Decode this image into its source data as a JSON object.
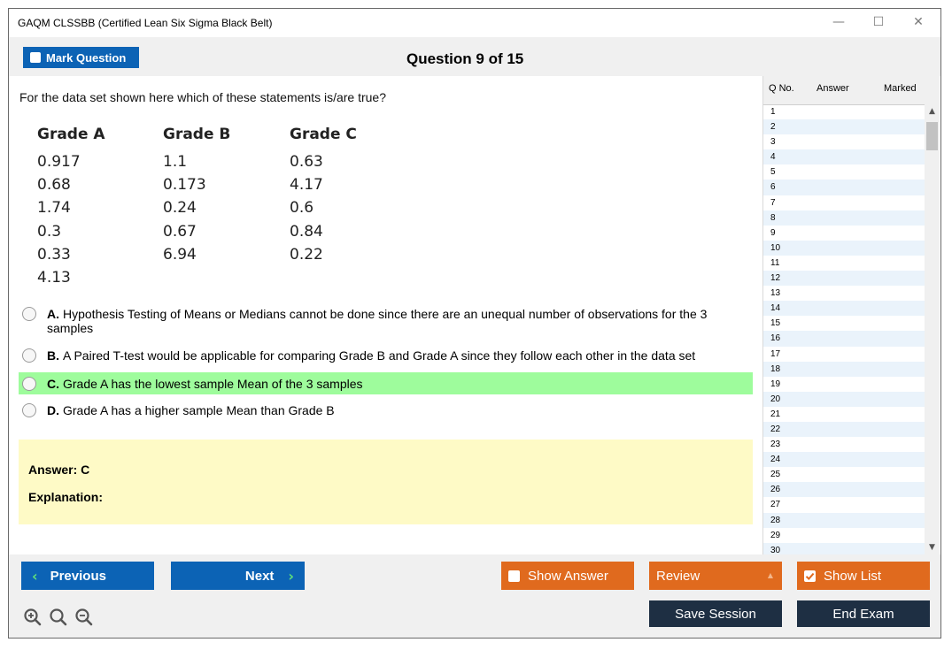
{
  "window": {
    "title": "GAQM CLSSBB (Certified Lean Six Sigma Black Belt)",
    "minimize_icon": "minimize-icon",
    "maximize_icon": "maximize-icon",
    "close_icon": "close-icon"
  },
  "toolbar": {
    "mark_label": "Mark Question",
    "question_counter": "Question 9 of 15"
  },
  "question": {
    "text": "For the data set shown here which of these statements is/are true?",
    "table": {
      "columns": [
        {
          "header": "Grade A",
          "values": [
            "0.917",
            "0.68",
            "1.74",
            "0.3",
            "0.33",
            "4.13"
          ]
        },
        {
          "header": "Grade B",
          "values": [
            "1.1",
            "0.173",
            "0.24",
            "0.67",
            "6.94"
          ]
        },
        {
          "header": "Grade C",
          "values": [
            "0.63",
            "4.17",
            "0.6",
            "0.84",
            "0.22"
          ]
        }
      ]
    },
    "options": [
      {
        "letter": "A.",
        "text": "Hypothesis Testing of Means or Medians cannot be done since there are an unequal number of observations for the 3 samples"
      },
      {
        "letter": "B.",
        "text": "A Paired T-test would be applicable for comparing Grade B and Grade A since they follow each other in the data set"
      },
      {
        "letter": "C.",
        "text": "Grade A has the lowest sample Mean of the 3 samples",
        "highlighted": true
      },
      {
        "letter": "D.",
        "text": "Grade A has a higher sample Mean than Grade B"
      }
    ]
  },
  "answer": {
    "answer_text": "Answer: C",
    "explanation_label": "Explanation:"
  },
  "question_list": {
    "headers": {
      "qno": "Q No.",
      "answer": "Answer",
      "marked": "Marked"
    },
    "rows": [
      "1",
      "2",
      "3",
      "4",
      "5",
      "6",
      "7",
      "8",
      "9",
      "10",
      "11",
      "12",
      "13",
      "14",
      "15",
      "16",
      "17",
      "18",
      "19",
      "20",
      "21",
      "22",
      "23",
      "24",
      "25",
      "26",
      "27",
      "28",
      "29",
      "30"
    ]
  },
  "nav": {
    "previous_label": "Previous",
    "next_label": "Next",
    "show_answer_label": "Show Answer",
    "review_label": "Review",
    "show_list_label": "Show List",
    "save_session_label": "Save Session",
    "end_exam_label": "End Exam"
  },
  "colors": {
    "primary_blue": "#0c63b5",
    "accent_orange": "#e06a1e",
    "dark_navy": "#1e2f43",
    "correct_highlight": "#9efc9c",
    "answer_box": "#fefac6"
  }
}
